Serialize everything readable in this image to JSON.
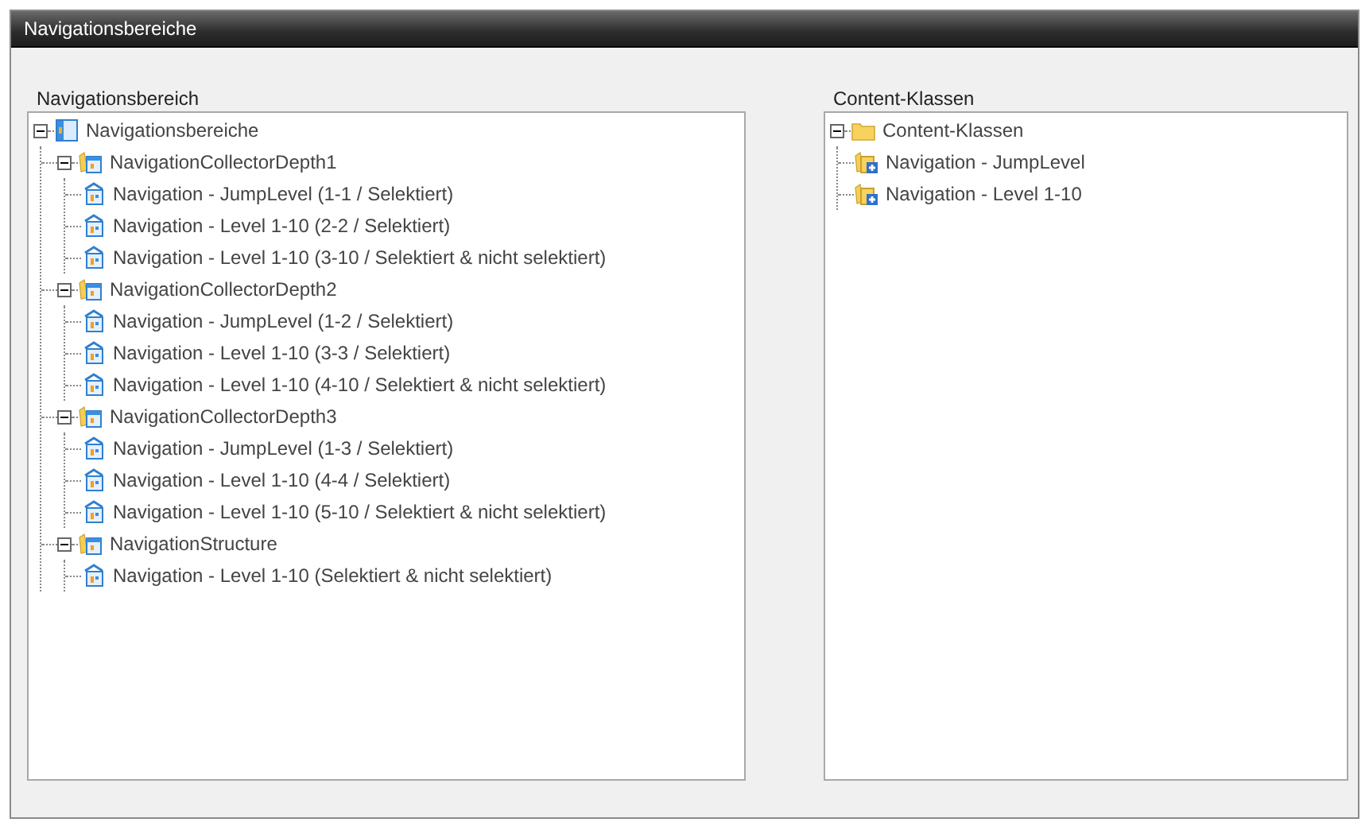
{
  "window": {
    "title": "Navigationsbereiche"
  },
  "panels": [
    {
      "label": "Navigationsbereich",
      "tree": [
        {
          "kind": "area",
          "label": "Navigationsbereiche",
          "expanded": true,
          "children": [
            {
              "kind": "collector",
              "label": "NavigationCollectorDepth1",
              "expanded": true,
              "children": [
                {
                  "kind": "item",
                  "label": "Navigation - JumpLevel (1-1 / Selektiert)"
                },
                {
                  "kind": "item",
                  "label": "Navigation - Level 1-10 (2-2 / Selektiert)"
                },
                {
                  "kind": "item",
                  "label": "Navigation - Level 1-10 (3-10 / Selektiert & nicht selektiert)"
                }
              ]
            },
            {
              "kind": "collector",
              "label": "NavigationCollectorDepth2",
              "expanded": true,
              "children": [
                {
                  "kind": "item",
                  "label": "Navigation - JumpLevel (1-2 / Selektiert)"
                },
                {
                  "kind": "item",
                  "label": "Navigation - Level 1-10 (3-3 / Selektiert)"
                },
                {
                  "kind": "item",
                  "label": "Navigation - Level 1-10 (4-10 / Selektiert & nicht selektiert)"
                }
              ]
            },
            {
              "kind": "collector",
              "label": "NavigationCollectorDepth3",
              "expanded": true,
              "children": [
                {
                  "kind": "item",
                  "label": "Navigation - JumpLevel (1-3 / Selektiert)"
                },
                {
                  "kind": "item",
                  "label": "Navigation - Level 1-10 (4-4 / Selektiert)"
                },
                {
                  "kind": "item",
                  "label": "Navigation - Level 1-10 (5-10 / Selektiert & nicht selektiert)"
                }
              ]
            },
            {
              "kind": "collector",
              "label": "NavigationStructure",
              "expanded": true,
              "children": [
                {
                  "kind": "item",
                  "label": "Navigation - Level 1-10 (Selektiert & nicht selektiert)"
                }
              ]
            }
          ]
        }
      ]
    },
    {
      "label": "Content-Klassen",
      "tree": [
        {
          "kind": "folder",
          "label": "Content-Klassen",
          "expanded": true,
          "children": [
            {
              "kind": "class",
              "label": "Navigation - JumpLevel"
            },
            {
              "kind": "class",
              "label": "Navigation - Level 1-10"
            }
          ]
        }
      ]
    }
  ]
}
